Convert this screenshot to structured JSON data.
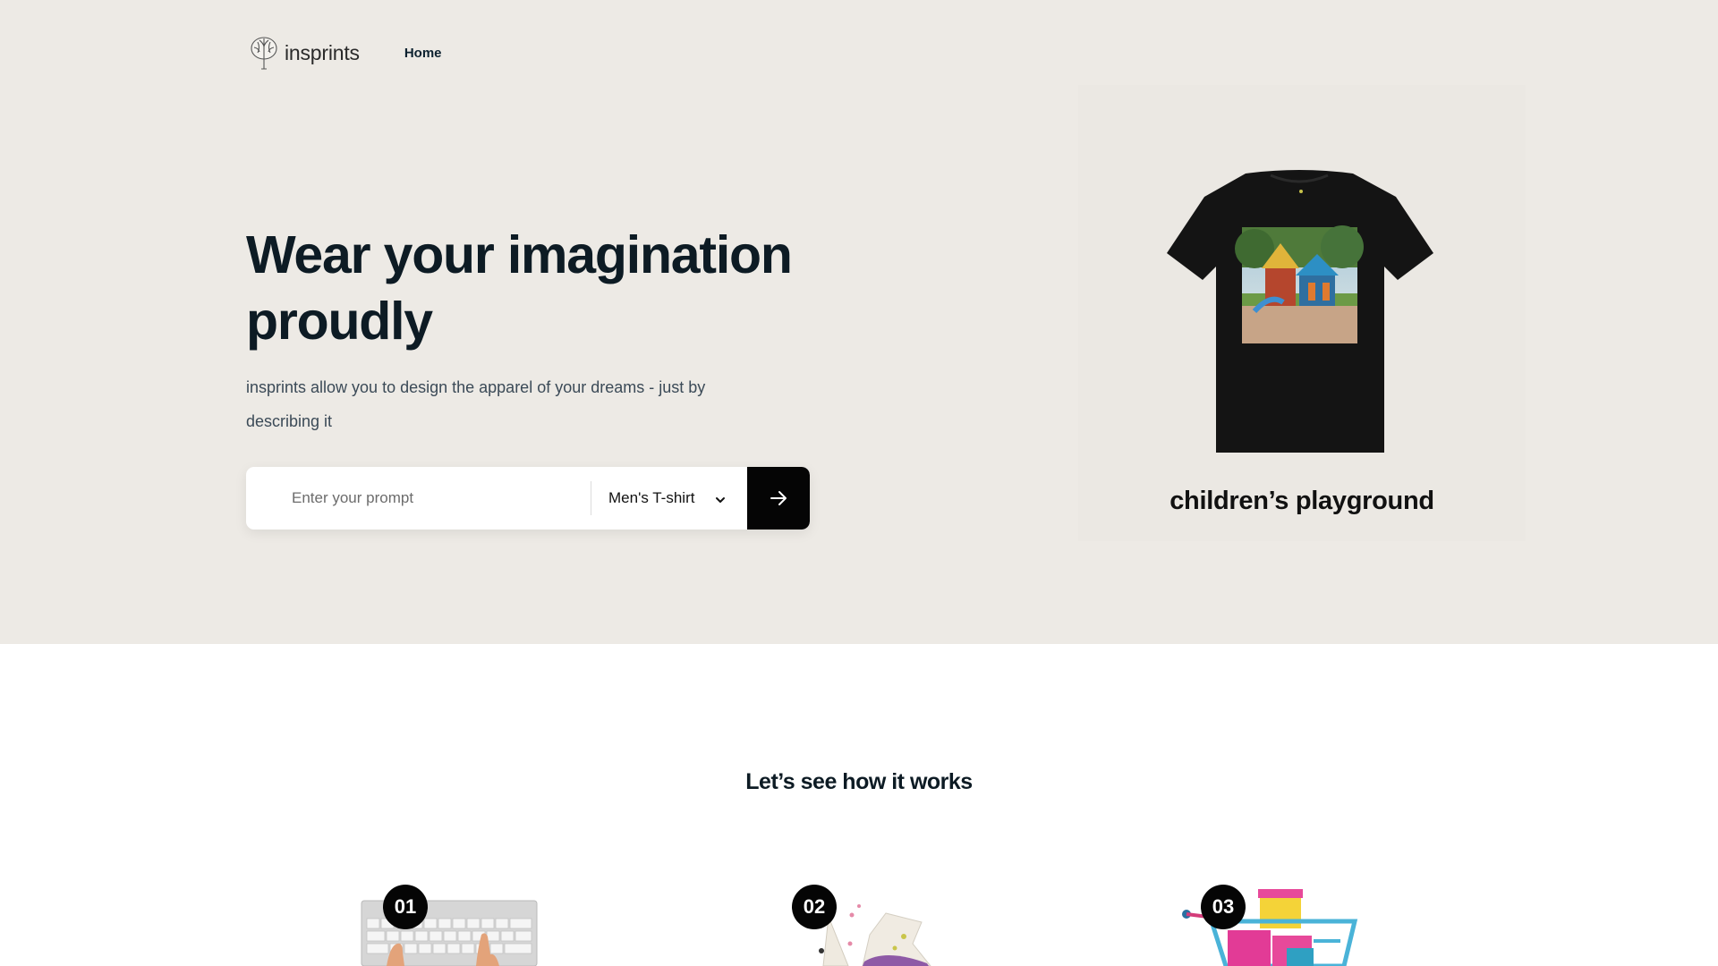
{
  "nav": {
    "brand": "insprints",
    "home_label": "Home"
  },
  "hero": {
    "headline": "Wear your imagination proudly",
    "subtext": "insprints allow you to design the apparel of your dreams - just by describing it",
    "prompt_placeholder": "Enter your prompt",
    "apparel_selected": "Men's T-shirt",
    "showcase_caption": "children’s playground"
  },
  "how_it_works": {
    "title": "Let’s see how it works",
    "steps": [
      {
        "number": "01",
        "icon": "keyboard-typing-illustration"
      },
      {
        "number": "02",
        "icon": "lab-flask-illustration"
      },
      {
        "number": "03",
        "icon": "shopping-cart-illustration"
      }
    ]
  },
  "colors": {
    "hero_bg": "#edeae5",
    "text_dark": "#0d1b24",
    "button_black": "#050505"
  }
}
